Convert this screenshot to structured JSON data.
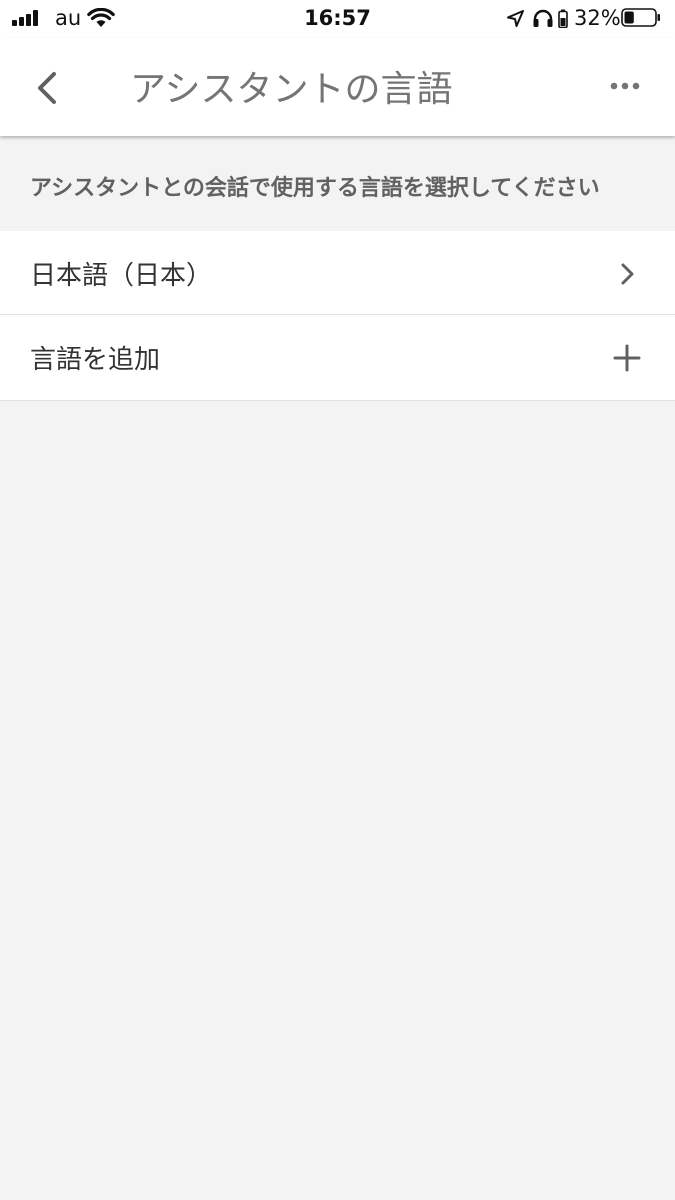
{
  "status_bar": {
    "carrier": "au",
    "time": "16:57",
    "battery_percent": "32%",
    "battery_level": 0.32,
    "icons": [
      "signal-icon",
      "wifi-icon",
      "location-icon",
      "headphones-icon",
      "battery-icon"
    ]
  },
  "app_bar": {
    "title": "アシスタントの言語",
    "back_icon": "chevron-left-icon",
    "more_icon": "more-horizontal-icon"
  },
  "description": "アシスタントとの会話で使用する言語を選択してください",
  "languages": {
    "items": [
      {
        "label": "日本語（日本）",
        "icon": "chevron-right-icon"
      },
      {
        "label": "言語を追加",
        "icon": "plus-icon"
      }
    ]
  },
  "colors": {
    "background": "#f3f3f3",
    "surface": "#ffffff",
    "title_text": "#757575",
    "body_text": "#333333",
    "secondary_text": "#616161",
    "divider": "#e0e0e0"
  }
}
